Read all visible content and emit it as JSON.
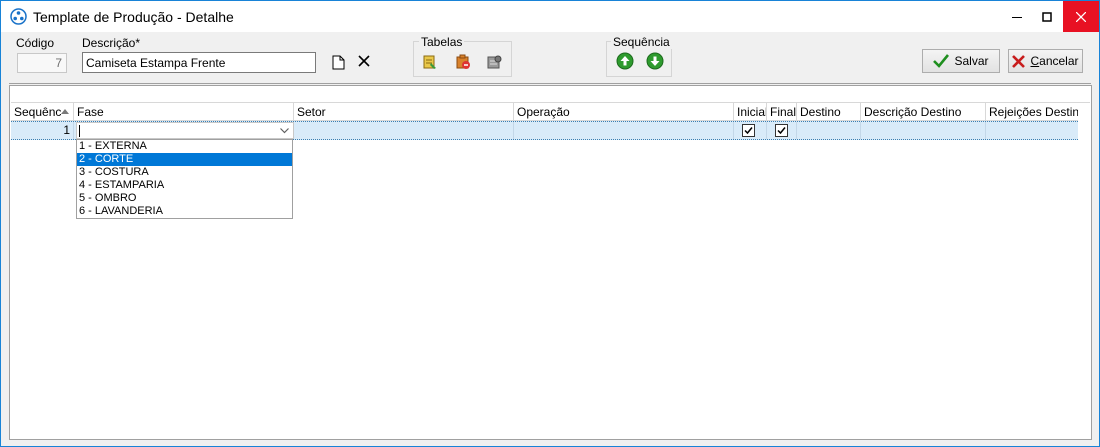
{
  "window": {
    "title": "Template de Produção - Detalhe",
    "minimize_symbol": "─",
    "maximize_symbol": "□",
    "close_symbol": "✕"
  },
  "form": {
    "codigo_label": "Código",
    "codigo_value": "7",
    "descricao_label": "Descrição*",
    "descricao_value": "Camiseta Estampa Frente",
    "icons": [
      "new-document-icon",
      "clear-x-icon"
    ]
  },
  "tabelas": {
    "title": "Tabelas",
    "icons": [
      "table-edit-icon",
      "table-delete-icon",
      "table-settings-icon"
    ]
  },
  "sequencia": {
    "title": "Sequência",
    "icons": [
      "arrow-up-icon",
      "arrow-down-icon"
    ]
  },
  "buttons": {
    "salvar": "Salvar",
    "cancelar_underlined": "C",
    "cancelar_rest": "ancelar"
  },
  "grid": {
    "columns": [
      "Sequênc",
      "Fase",
      "Setor",
      "Operação",
      "Inicial",
      "Final",
      "Destino",
      "Descrição Destino",
      "Rejeições Destino"
    ],
    "sorted_column": "Sequênc",
    "rows": [
      {
        "sequencia": "1",
        "fase": "",
        "setor": "",
        "operacao": "",
        "inicial": true,
        "final": true,
        "destino": "",
        "descricao_destino": "",
        "rejeicoes_destino": ""
      }
    ]
  },
  "fase_dropdown": {
    "options": [
      "1 - EXTERNA",
      "2 - CORTE",
      "3 - COSTURA",
      "4 - ESTAMPARIA",
      "5 - OMBRO",
      "6 - LAVANDERIA"
    ],
    "highlighted_index": 1
  },
  "colors": {
    "accent": "#0078d7",
    "close_button": "#e81123",
    "row_selected": "#d9ebf9",
    "arrow_green": "#2e9b2e"
  }
}
